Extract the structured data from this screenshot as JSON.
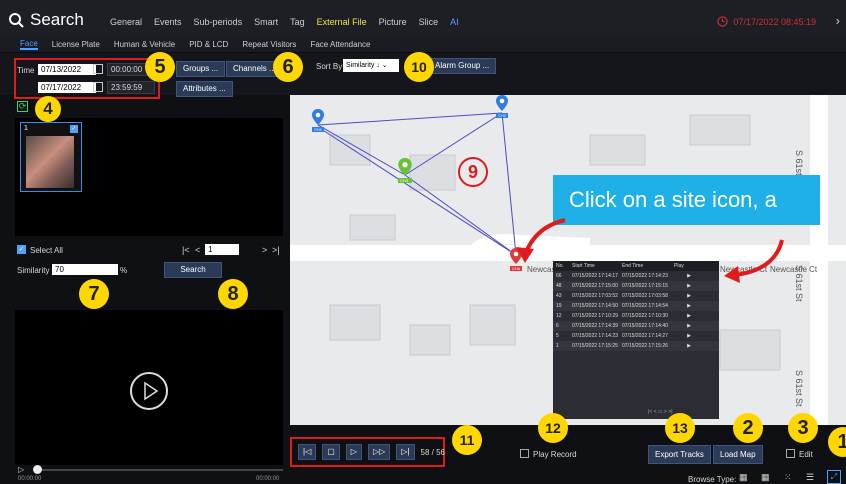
{
  "header": {
    "title": "Search",
    "tabs": [
      "General",
      "Events",
      "Sub-periods",
      "Smart",
      "Tag",
      "External File",
      "Picture",
      "Slice",
      "AI"
    ],
    "clock": "07/17/2022 08:45:19"
  },
  "subtabs": [
    "Face",
    "License Plate",
    "Human & Vehicle",
    "PID & LCD",
    "Repeat Visitors",
    "Face Attendance"
  ],
  "filters": {
    "time_label": "Time",
    "start_date": "07/13/2022",
    "start_time": "00:00:00",
    "end_date": "07/17/2022",
    "end_time": "23:59:59",
    "groups_label": "Groups ...",
    "channels_label": "Channels ...",
    "attributes_label": "Attributes ...",
    "sort_label": "Sort By",
    "sort_value": "Similarity ↓",
    "alarm_group_label": "Alarm Group ..."
  },
  "results": {
    "card_number": "1",
    "select_all": "Select All",
    "page": "1",
    "similarity_label": "Similarity",
    "similarity_value": "70",
    "percent": "%",
    "search_label": "Search"
  },
  "player": {
    "time_start": "00:00:00",
    "time_end": "00:00:00"
  },
  "map": {
    "streets": [
      "Newcastle Ct",
      "Newcastle Ct",
      "Newcastle Ct"
    ],
    "avenue": [
      "S 61st St",
      "S 61st St",
      "S 61st St"
    ],
    "pin_labels": [
      "CH1",
      "CH2",
      "CH3",
      "CH4"
    ],
    "callout": "Click on a site icon, a",
    "table_headers": [
      "No.",
      "Start Time",
      "End Time",
      "Play"
    ],
    "table_rows": [
      [
        "66",
        "07/15/2022 17:14:17",
        "07/15/2022 17:14:23"
      ],
      [
        "48",
        "07/15/2022 17:15:00",
        "07/15/2022 17:15:15"
      ],
      [
        "43",
        "07/15/2022 17:03:52",
        "07/15/2022 17:03:58"
      ],
      [
        "19",
        "07/15/2022 17:14:50",
        "07/15/2022 17:14:54"
      ],
      [
        "12",
        "07/15/2022 17:10:29",
        "07/15/2022 17:10:30"
      ],
      [
        "6",
        "07/15/2022 17:14:39",
        "07/15/2022 17:14:40"
      ],
      [
        "5",
        "07/15/2022 17:14:23",
        "07/15/2022 17:14:27"
      ],
      [
        "1",
        "07/15/2022 17:15:25",
        "07/15/2022 17:15:26"
      ]
    ]
  },
  "controls": {
    "track_count": "58 / 56",
    "play_record": "Play Record",
    "export_tracks": "Export Tracks",
    "load_map": "Load Map",
    "edit": "Edit",
    "browse_type": "Browse Type:"
  },
  "badges": [
    "1",
    "2",
    "3",
    "4",
    "5",
    "6",
    "7",
    "8",
    "9",
    "10",
    "11",
    "12",
    "13"
  ],
  "colors": {
    "accent": "#4fa3ff",
    "highlight": "#f3e04a",
    "annotation": "#e01b1b",
    "badge": "#ffd700",
    "callout": "#1fb0e8"
  }
}
